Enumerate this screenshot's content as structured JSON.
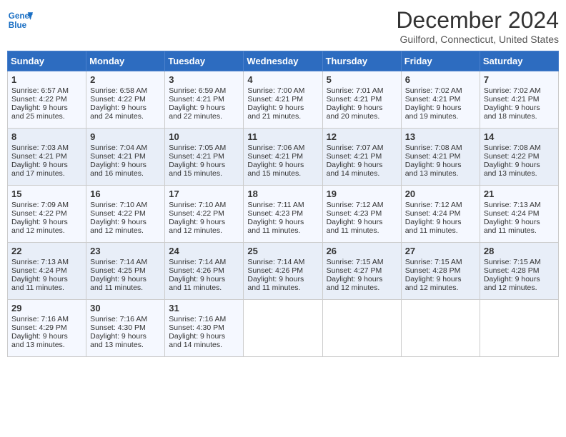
{
  "header": {
    "logo_line1": "General",
    "logo_line2": "Blue",
    "month_title": "December 2024",
    "location": "Guilford, Connecticut, United States"
  },
  "days_of_week": [
    "Sunday",
    "Monday",
    "Tuesday",
    "Wednesday",
    "Thursday",
    "Friday",
    "Saturday"
  ],
  "weeks": [
    [
      {
        "day": 1,
        "sunrise": "6:57 AM",
        "sunset": "4:22 PM",
        "daylight": "9 hours and 25 minutes."
      },
      {
        "day": 2,
        "sunrise": "6:58 AM",
        "sunset": "4:22 PM",
        "daylight": "9 hours and 24 minutes."
      },
      {
        "day": 3,
        "sunrise": "6:59 AM",
        "sunset": "4:21 PM",
        "daylight": "9 hours and 22 minutes."
      },
      {
        "day": 4,
        "sunrise": "7:00 AM",
        "sunset": "4:21 PM",
        "daylight": "9 hours and 21 minutes."
      },
      {
        "day": 5,
        "sunrise": "7:01 AM",
        "sunset": "4:21 PM",
        "daylight": "9 hours and 20 minutes."
      },
      {
        "day": 6,
        "sunrise": "7:02 AM",
        "sunset": "4:21 PM",
        "daylight": "9 hours and 19 minutes."
      },
      {
        "day": 7,
        "sunrise": "7:02 AM",
        "sunset": "4:21 PM",
        "daylight": "9 hours and 18 minutes."
      }
    ],
    [
      {
        "day": 8,
        "sunrise": "7:03 AM",
        "sunset": "4:21 PM",
        "daylight": "9 hours and 17 minutes."
      },
      {
        "day": 9,
        "sunrise": "7:04 AM",
        "sunset": "4:21 PM",
        "daylight": "9 hours and 16 minutes."
      },
      {
        "day": 10,
        "sunrise": "7:05 AM",
        "sunset": "4:21 PM",
        "daylight": "9 hours and 15 minutes."
      },
      {
        "day": 11,
        "sunrise": "7:06 AM",
        "sunset": "4:21 PM",
        "daylight": "9 hours and 15 minutes."
      },
      {
        "day": 12,
        "sunrise": "7:07 AM",
        "sunset": "4:21 PM",
        "daylight": "9 hours and 14 minutes."
      },
      {
        "day": 13,
        "sunrise": "7:08 AM",
        "sunset": "4:21 PM",
        "daylight": "9 hours and 13 minutes."
      },
      {
        "day": 14,
        "sunrise": "7:08 AM",
        "sunset": "4:22 PM",
        "daylight": "9 hours and 13 minutes."
      }
    ],
    [
      {
        "day": 15,
        "sunrise": "7:09 AM",
        "sunset": "4:22 PM",
        "daylight": "9 hours and 12 minutes."
      },
      {
        "day": 16,
        "sunrise": "7:10 AM",
        "sunset": "4:22 PM",
        "daylight": "9 hours and 12 minutes."
      },
      {
        "day": 17,
        "sunrise": "7:10 AM",
        "sunset": "4:22 PM",
        "daylight": "9 hours and 12 minutes."
      },
      {
        "day": 18,
        "sunrise": "7:11 AM",
        "sunset": "4:23 PM",
        "daylight": "9 hours and 11 minutes."
      },
      {
        "day": 19,
        "sunrise": "7:12 AM",
        "sunset": "4:23 PM",
        "daylight": "9 hours and 11 minutes."
      },
      {
        "day": 20,
        "sunrise": "7:12 AM",
        "sunset": "4:24 PM",
        "daylight": "9 hours and 11 minutes."
      },
      {
        "day": 21,
        "sunrise": "7:13 AM",
        "sunset": "4:24 PM",
        "daylight": "9 hours and 11 minutes."
      }
    ],
    [
      {
        "day": 22,
        "sunrise": "7:13 AM",
        "sunset": "4:24 PM",
        "daylight": "9 hours and 11 minutes."
      },
      {
        "day": 23,
        "sunrise": "7:14 AM",
        "sunset": "4:25 PM",
        "daylight": "9 hours and 11 minutes."
      },
      {
        "day": 24,
        "sunrise": "7:14 AM",
        "sunset": "4:26 PM",
        "daylight": "9 hours and 11 minutes."
      },
      {
        "day": 25,
        "sunrise": "7:14 AM",
        "sunset": "4:26 PM",
        "daylight": "9 hours and 11 minutes."
      },
      {
        "day": 26,
        "sunrise": "7:15 AM",
        "sunset": "4:27 PM",
        "daylight": "9 hours and 12 minutes."
      },
      {
        "day": 27,
        "sunrise": "7:15 AM",
        "sunset": "4:28 PM",
        "daylight": "9 hours and 12 minutes."
      },
      {
        "day": 28,
        "sunrise": "7:15 AM",
        "sunset": "4:28 PM",
        "daylight": "9 hours and 12 minutes."
      }
    ],
    [
      {
        "day": 29,
        "sunrise": "7:16 AM",
        "sunset": "4:29 PM",
        "daylight": "9 hours and 13 minutes."
      },
      {
        "day": 30,
        "sunrise": "7:16 AM",
        "sunset": "4:30 PM",
        "daylight": "9 hours and 13 minutes."
      },
      {
        "day": 31,
        "sunrise": "7:16 AM",
        "sunset": "4:30 PM",
        "daylight": "9 hours and 14 minutes."
      },
      null,
      null,
      null,
      null
    ]
  ]
}
